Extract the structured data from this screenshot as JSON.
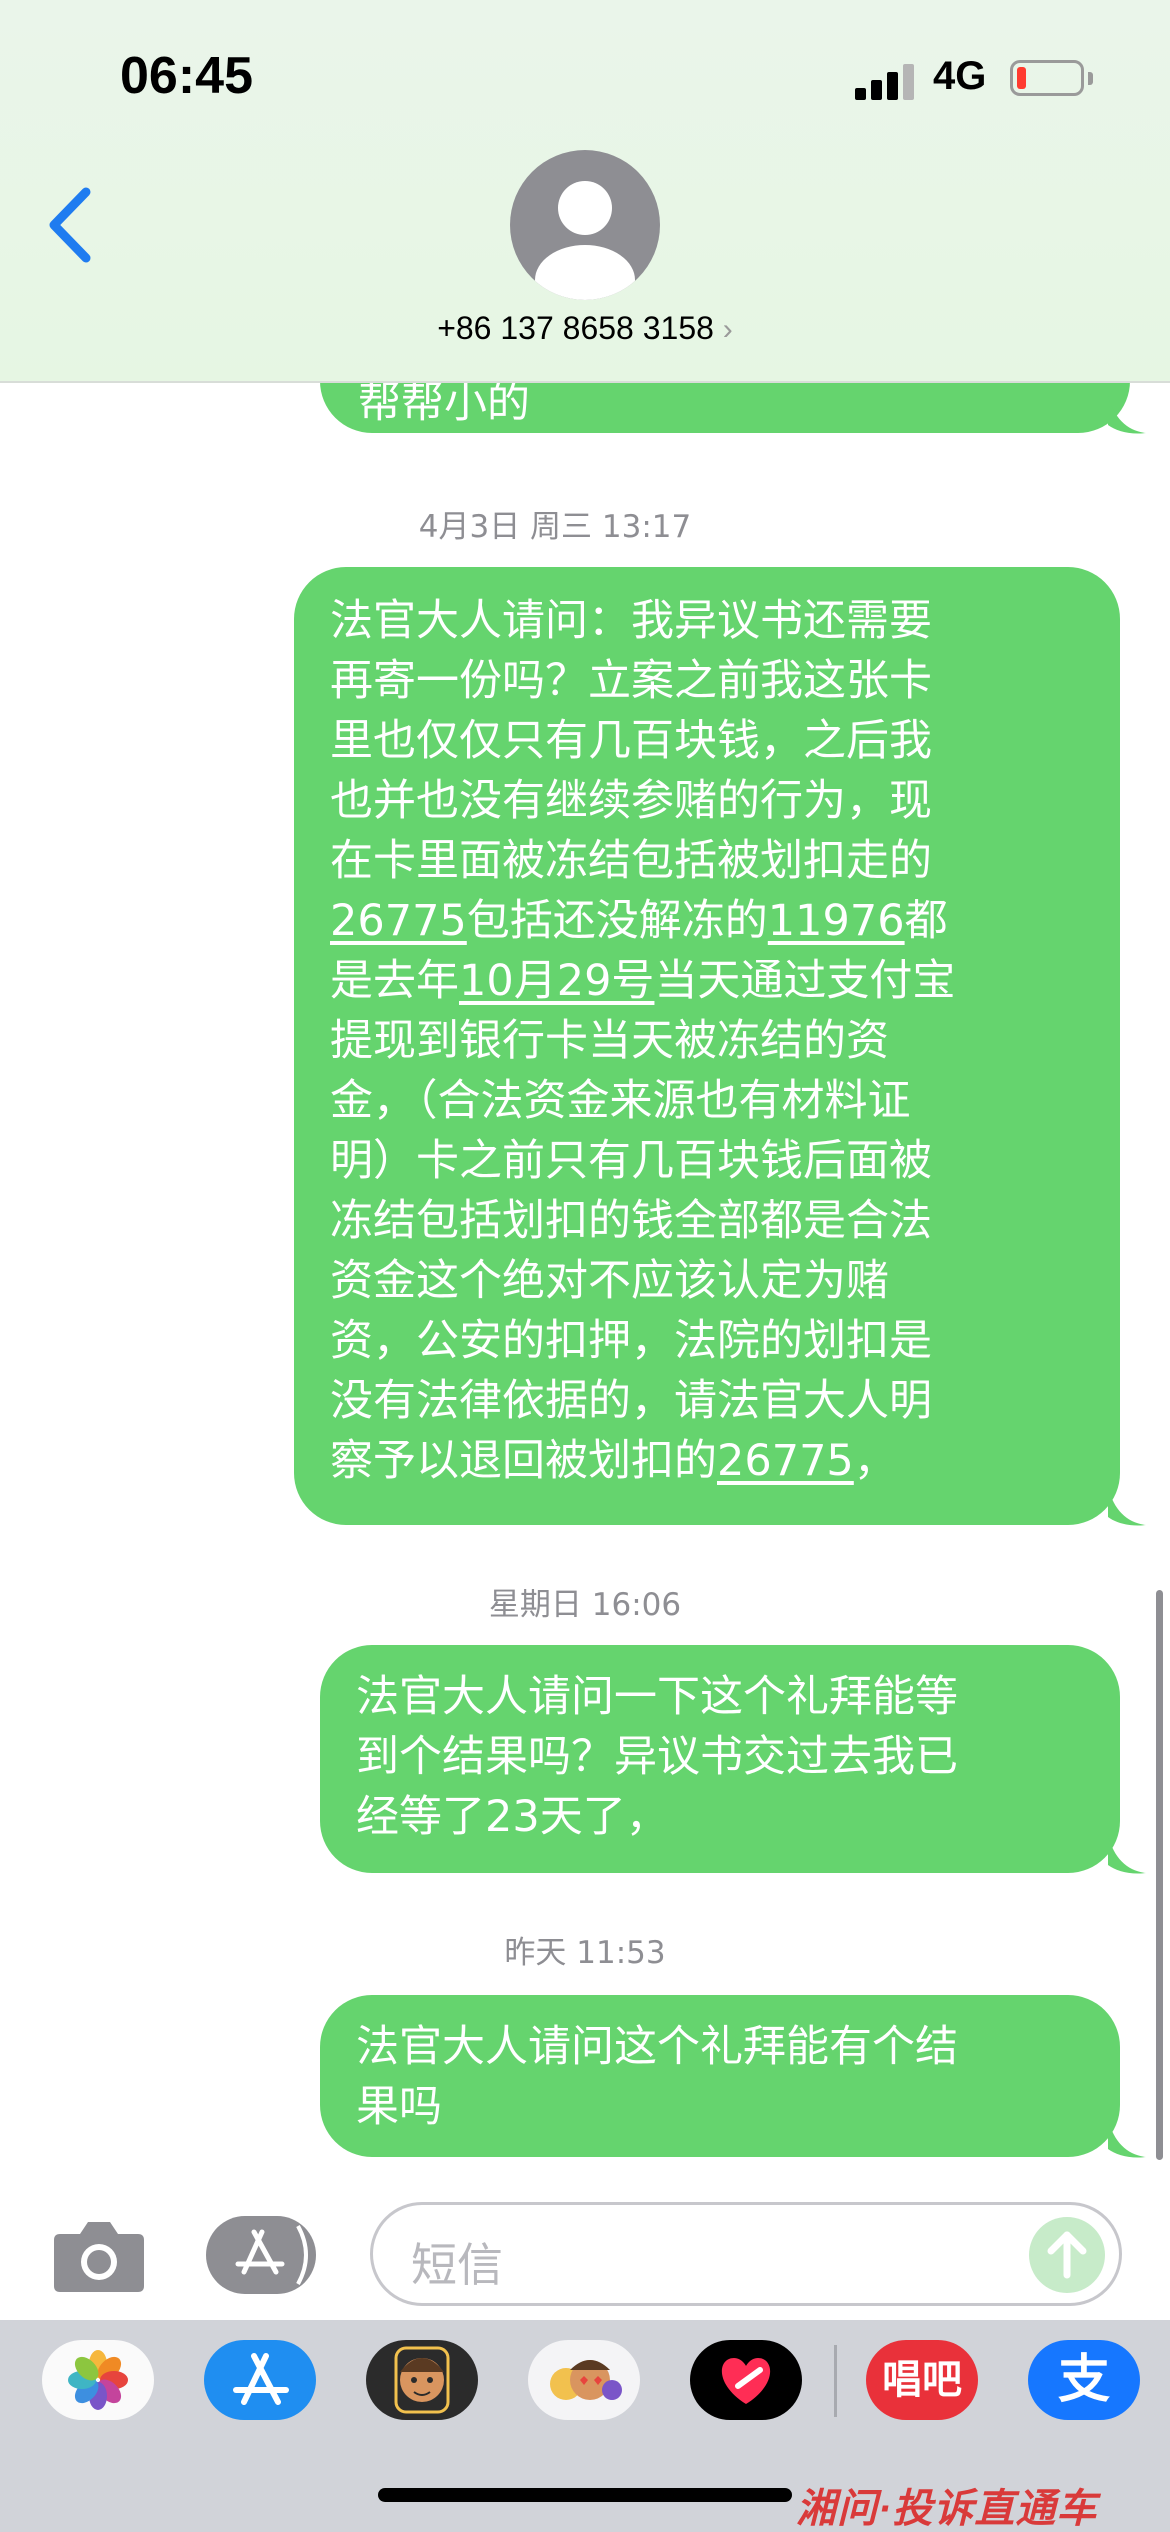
{
  "status_bar": {
    "time": "06:45",
    "network": "4G"
  },
  "header": {
    "contact_number": "+86 137 8658 3158",
    "chevron": "›"
  },
  "messages": [
    {
      "type": "sent",
      "partial": true,
      "lines": [
        "帮帮小的"
      ]
    },
    {
      "timestamp": "4月3日 周三 13:17"
    },
    {
      "type": "sent",
      "lines": [
        "法官大人请问：我异议书还需要",
        "再寄一份吗？立案之前我这张卡",
        "里也仅仅只有几百块钱，之后我",
        "也并也没有继续参赌的行为，现",
        "在卡里面被冻结包括被划扣走的",
        "26775包括还没解冻的11976都",
        "是去年10月29号当天通过支付宝",
        "提现到银行卡当天被冻结的资",
        "金，（合法资金来源也有材料证",
        "明）卡之前只有几百块钱后面被",
        "冻结包括划扣的钱全部都是合法",
        "资金这个绝对不应该认定为赌",
        "资，公安的扣押，法院的划扣是",
        "没有法律依据的，请法官大人明",
        "察予以退回被划扣的26775，"
      ],
      "links": [
        "26775",
        "11976",
        "10月29号"
      ]
    },
    {
      "timestamp": "星期日 16:06"
    },
    {
      "type": "sent",
      "lines": [
        "法官大人请问一下这个礼拜能等",
        "到个结果吗？异议书交过去我已",
        "经等了23天了，"
      ]
    },
    {
      "timestamp": "昨天 11:53"
    },
    {
      "type": "sent",
      "lines": [
        "法官大人请问这个礼拜能有个结",
        "果吗"
      ]
    }
  ],
  "input_bar": {
    "placeholder": "短信",
    "camera_icon": "camera-icon",
    "apps_icon": "app-store-icon",
    "send_icon": "send-arrow-icon"
  },
  "app_drawer": {
    "apps": [
      "photos-icon",
      "app-store-icon",
      "memoji-icon",
      "memoji-stickers-icon",
      "digital-touch-icon",
      "changba-icon",
      "alipay-icon"
    ],
    "changba_label": "唱吧",
    "alipay_label": "支"
  },
  "watermark": "湘问·投诉直通车",
  "colors": {
    "bubble_green": "#65d46e",
    "header_bg": "#eaf5ea",
    "back_blue": "#1f7cf0",
    "timestamp_gray": "#8e8e93"
  }
}
